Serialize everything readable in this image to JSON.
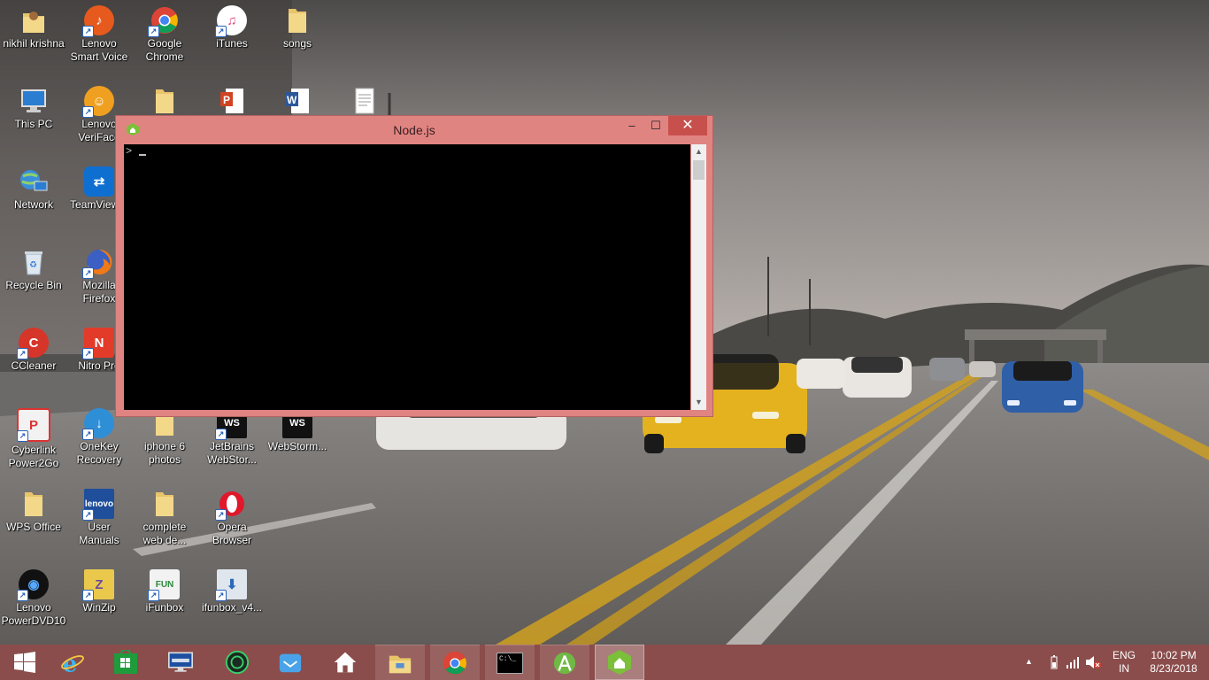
{
  "desktop": {
    "icons": [
      {
        "label": "nikhil krishna",
        "icon": "user-folder-icon"
      },
      {
        "label": "Lenovo Smart Voice",
        "icon": "lenovo-smart-voice-icon"
      },
      {
        "label": "Google Chrome",
        "icon": "chrome-icon"
      },
      {
        "label": "iTunes",
        "icon": "itunes-icon"
      },
      {
        "label": "songs",
        "icon": "folder-icon"
      },
      {
        "label": "This PC",
        "icon": "this-pc-icon"
      },
      {
        "label": "Lenovo VeriFace",
        "icon": "lenovo-veriface-icon"
      },
      {
        "label": "",
        "icon": "folder-icon"
      },
      {
        "label": "",
        "icon": "powerpoint-file-icon"
      },
      {
        "label": "",
        "icon": "word-file-icon"
      },
      {
        "label": "",
        "icon": "text-file-icon"
      },
      {
        "label": "Network",
        "icon": "network-icon"
      },
      {
        "label": "TeamViewer",
        "icon": "teamviewer-icon"
      },
      {
        "label": "Recycle Bin",
        "icon": "recycle-bin-icon"
      },
      {
        "label": "Mozilla Firefox",
        "icon": "firefox-icon"
      },
      {
        "label": "CCleaner",
        "icon": "ccleaner-icon"
      },
      {
        "label": "Nitro Pro",
        "icon": "nitro-pro-icon"
      },
      {
        "label": "Cyberlink Power2Go",
        "icon": "power2go-icon"
      },
      {
        "label": "OneKey Recovery",
        "icon": "onekey-recovery-icon"
      },
      {
        "label": "iphone 6 photos",
        "icon": "folder-icon"
      },
      {
        "label": "JetBrains WebStor...",
        "icon": "webstorm-icon"
      },
      {
        "label": "WebStorm...",
        "icon": "webstorm-file-icon"
      },
      {
        "label": "WPS Office",
        "icon": "folder-icon"
      },
      {
        "label": "User Manuals",
        "icon": "user-manuals-icon"
      },
      {
        "label": "complete web de...",
        "icon": "folder-icon"
      },
      {
        "label": "Opera Browser",
        "icon": "opera-icon"
      },
      {
        "label": "Lenovo PowerDVD10",
        "icon": "powerdvd-icon"
      },
      {
        "label": "WinZip",
        "icon": "winzip-icon"
      },
      {
        "label": "iFunbox",
        "icon": "ifunbox-icon"
      },
      {
        "label": "ifunbox_v4...",
        "icon": "installer-icon"
      }
    ]
  },
  "console_window": {
    "title": "Node.js",
    "prompt": ">",
    "minimize": "–",
    "maximize": "☐",
    "close": "✕"
  },
  "taskbar": {
    "items": [
      {
        "icon": "windows-start-icon"
      },
      {
        "icon": "internet-explorer-icon"
      },
      {
        "icon": "windows-store-icon"
      },
      {
        "icon": "lenovo-desktop-icon"
      },
      {
        "icon": "circle-app-icon"
      },
      {
        "icon": "mail-app-icon"
      },
      {
        "icon": "nodejs-home-icon"
      },
      {
        "icon": "file-explorer-icon"
      },
      {
        "icon": "chrome-icon"
      },
      {
        "icon": "command-prompt-icon",
        "text": "C:\\_"
      },
      {
        "icon": "android-studio-icon"
      },
      {
        "icon": "nodejs-home-icon"
      }
    ],
    "tray": {
      "language_line1": "ENG",
      "language_line2": "IN",
      "time": "10:02 PM",
      "date": "8/23/2018"
    }
  },
  "colors": {
    "window_frame": "#e08482",
    "taskbar": "#8a4d4b",
    "close_button": "#c7504c"
  }
}
